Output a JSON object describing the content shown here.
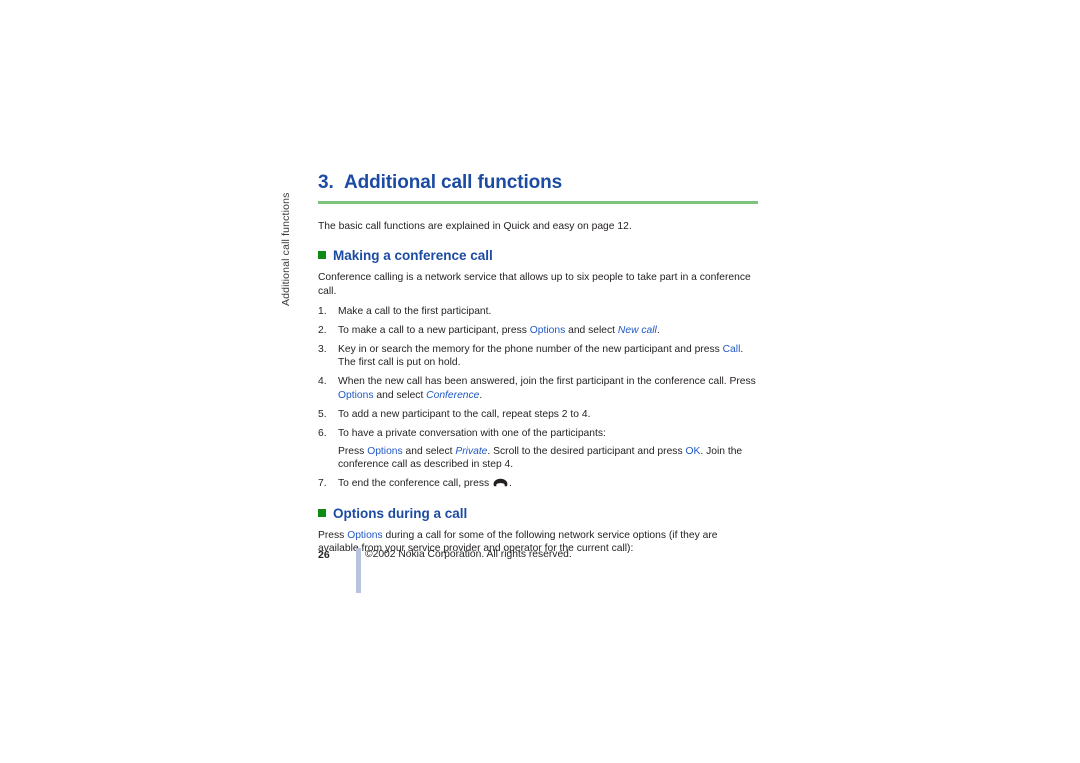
{
  "page": {
    "running_head": "Additional call functions",
    "page_number": "26",
    "copyright": "©2002 Nokia Corporation. All rights reserved."
  },
  "chapter": {
    "number": "3.",
    "title": "Additional call functions",
    "intro": "The basic call functions are explained in Quick and easy on page 12."
  },
  "colors": {
    "heading_blue": "#1c4ba3",
    "inline_blue": "#2159c4",
    "bullet_green": "#0e8a16",
    "rule_green": "#7cc47c",
    "footer_bar": "#b9c3e0",
    "body_text": "#231f20"
  },
  "sections": [
    {
      "id": "making-a-conference-call",
      "heading": "Making a conference call",
      "bullet_icon": "green-square-bullet",
      "intro": "Conference calling is a network service that allows up to six people to take part in a conference call.",
      "steps": [
        {
          "marker": "1.",
          "parts": [
            {
              "t": "Make a call to the first participant.",
              "s": "plain"
            }
          ]
        },
        {
          "marker": "2.",
          "parts": [
            {
              "t": "To make a call to a new participant, press ",
              "s": "plain"
            },
            {
              "t": "Options",
              "s": "ui"
            },
            {
              "t": " and select ",
              "s": "plain"
            },
            {
              "t": "New call",
              "s": "italic"
            },
            {
              "t": ".",
              "s": "plain"
            }
          ]
        },
        {
          "marker": "3.",
          "parts": [
            {
              "t": "Key in or search the memory for the phone number of the new participant and press ",
              "s": "plain"
            },
            {
              "t": "Call",
              "s": "ui"
            },
            {
              "t": ". The first call is put on hold.",
              "s": "plain"
            }
          ]
        },
        {
          "marker": "4.",
          "parts": [
            {
              "t": "When the new call has been answered, join the first participant in the conference call. Press ",
              "s": "plain"
            },
            {
              "t": "Options",
              "s": "ui"
            },
            {
              "t": " and select ",
              "s": "plain"
            },
            {
              "t": "Conference",
              "s": "italic"
            },
            {
              "t": ".",
              "s": "plain"
            }
          ]
        },
        {
          "marker": "5.",
          "parts": [
            {
              "t": "To add a new participant to the call, repeat steps 2 to 4.",
              "s": "plain"
            }
          ]
        },
        {
          "marker": "6.",
          "parts": [
            {
              "t": "To have a private conversation with one of the participants:",
              "s": "plain"
            }
          ],
          "substep": [
            {
              "t": "Press ",
              "s": "plain"
            },
            {
              "t": "Options",
              "s": "ui"
            },
            {
              "t": " and select ",
              "s": "plain"
            },
            {
              "t": "Private",
              "s": "italic"
            },
            {
              "t": ". Scroll to the desired participant and press ",
              "s": "plain"
            },
            {
              "t": "OK",
              "s": "ui"
            },
            {
              "t": ". Join the conference call as described in step 4.",
              "s": "plain"
            }
          ]
        },
        {
          "marker": "7.",
          "parts": [
            {
              "t": "To end the conference call, press ",
              "s": "plain"
            },
            {
              "t": "",
              "s": "endcall-icon"
            },
            {
              "t": ".",
              "s": "plain"
            }
          ]
        }
      ]
    },
    {
      "id": "options-during-a-call",
      "heading": "Options during a call",
      "bullet_icon": "green-square-bullet",
      "paragraph": [
        {
          "t": "Press ",
          "s": "plain"
        },
        {
          "t": "Options",
          "s": "ui"
        },
        {
          "t": " during a call for some of the following network service options (if they are available from your service provider and operator for the current call):",
          "s": "plain"
        }
      ]
    }
  ]
}
